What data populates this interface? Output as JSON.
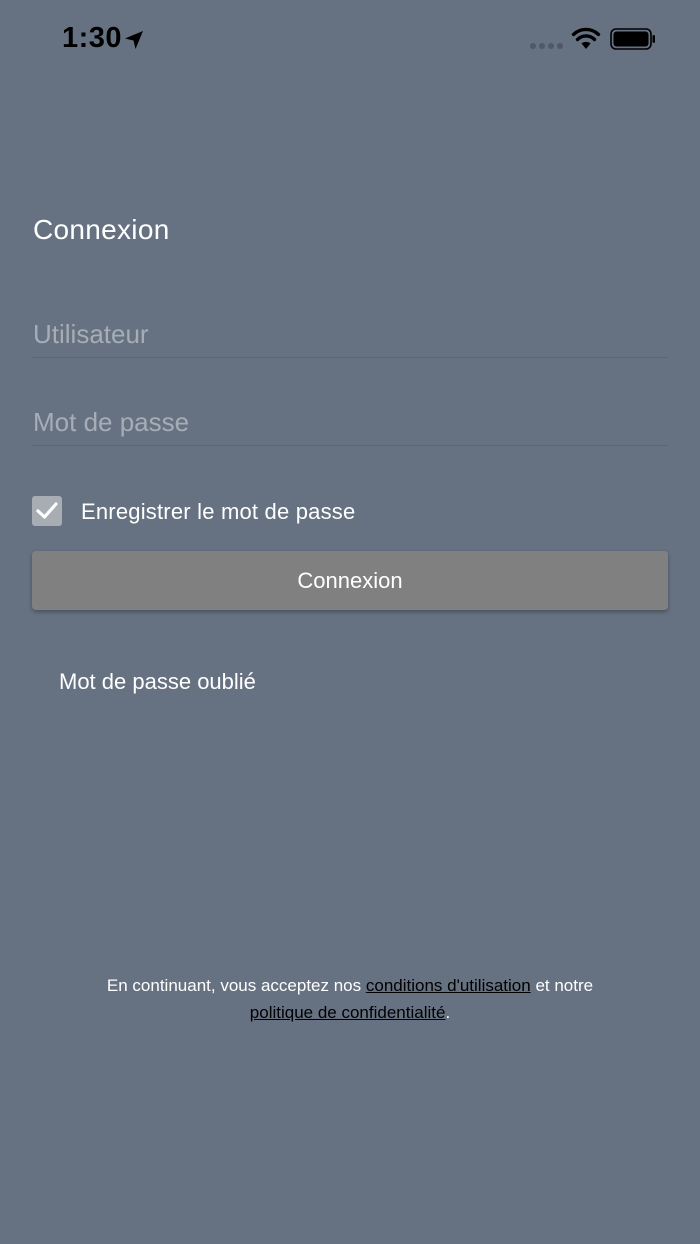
{
  "status_bar": {
    "time": "1:30",
    "icons": [
      "location-arrow-icon",
      "signal-icon",
      "wifi-icon",
      "battery-icon"
    ]
  },
  "login": {
    "title": "Connexion",
    "username_placeholder": "Utilisateur",
    "password_placeholder": "Mot de passe",
    "remember_label": "Enregistrer le mot de passe",
    "remember_checked": true,
    "submit_label": "Connexion",
    "forgot_label": "Mot de passe oublié"
  },
  "footer": {
    "prefix": "En continuant, vous acceptez nos ",
    "terms_link": "conditions d'utilisation",
    "middle": " et notre",
    "privacy_link": "politique de confidentialité",
    "suffix": "."
  },
  "colors": {
    "background": "#667282",
    "button": "#808080",
    "checkbox": "#a8adb3",
    "link": "#000000"
  }
}
